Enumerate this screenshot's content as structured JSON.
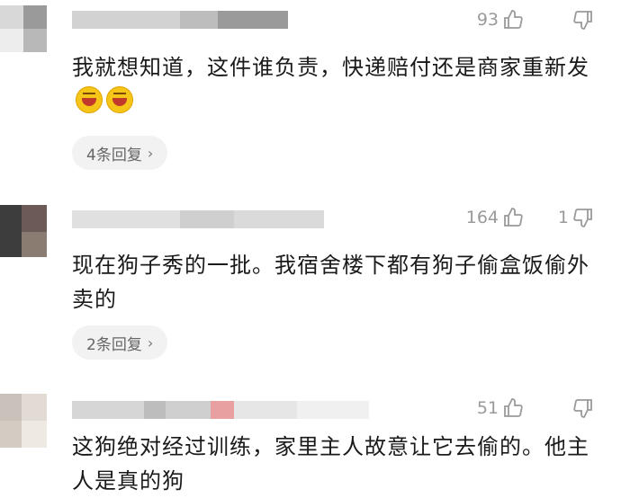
{
  "comments": [
    {
      "likes": "93",
      "dislikes": "",
      "text": "我就想知道，这件谁负责，快递赔付还是商家重新发",
      "emoji": [
        "grinning-squint-emoji",
        "grinning-squint-emoji"
      ],
      "replies": "4条回复"
    },
    {
      "likes": "164",
      "dislikes": "1",
      "text": "现在狗子秀的一批。我宿舍楼下都有狗子偷盒饭偷外卖的",
      "replies": "2条回复"
    },
    {
      "likes": "51",
      "dislikes": "",
      "text": "这狗绝对经过训练，家里主人故意让它去偷的。他主人是真的狗"
    }
  ],
  "icons": {
    "like": "thumbs-up-icon",
    "dislike": "thumbs-down-icon",
    "chevron": "chevron-right-icon"
  }
}
